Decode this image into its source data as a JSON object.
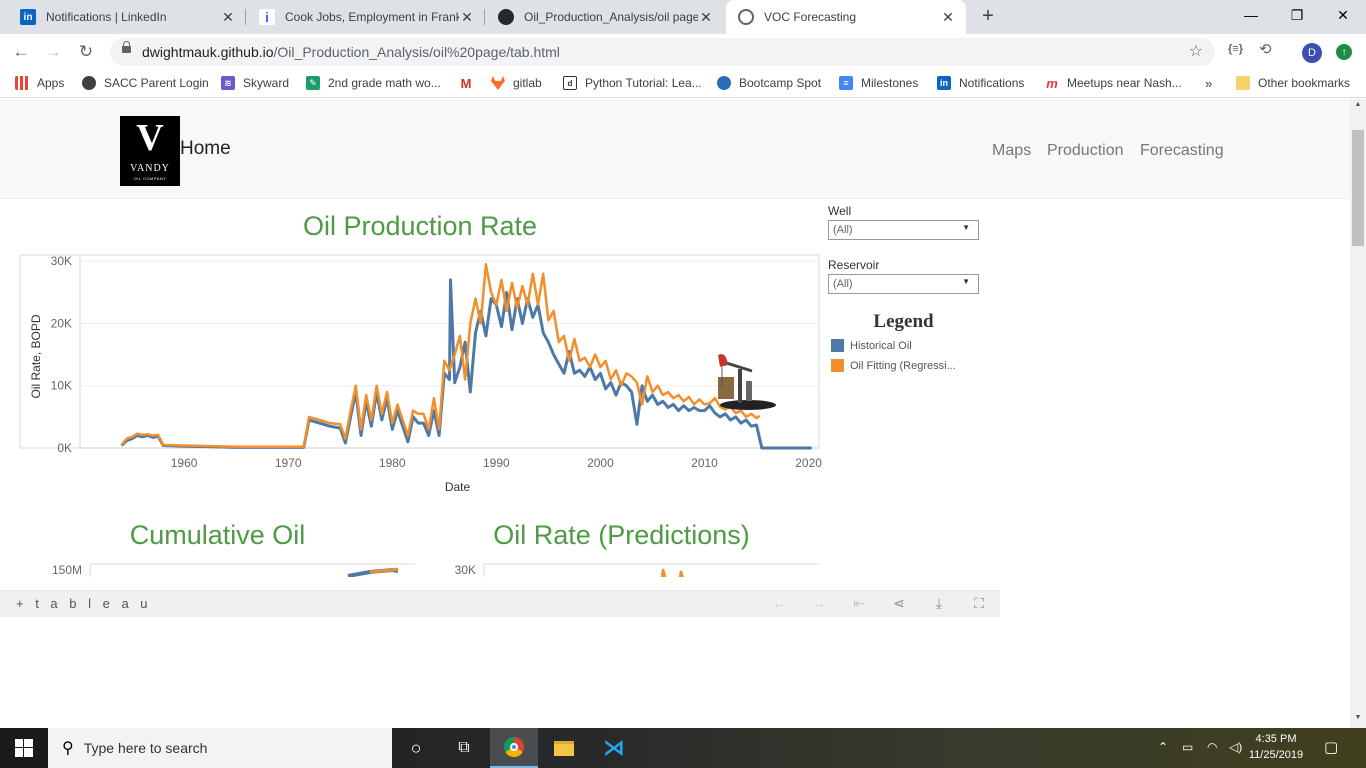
{
  "browser": {
    "tabs": [
      {
        "title": "Notifications | LinkedIn",
        "icon": "linkedin-icon",
        "color": "#0a66c2",
        "glyph": "in"
      },
      {
        "title": "Cook Jobs, Employment in Frankl",
        "icon": "indeed-icon",
        "color": "#2164f3",
        "glyph": "i"
      },
      {
        "title": "Oil_Production_Analysis/oil page",
        "icon": "github-icon",
        "color": "#24292e",
        "glyph": "●"
      },
      {
        "title": "VOC Forecasting",
        "icon": "globe-icon",
        "color": "#5f6368",
        "glyph": "◍"
      }
    ],
    "url_host": "dwightmauk.github.io",
    "url_path": "/Oil_Production_Analysis/oil%20page/tab.html",
    "profile_initial": "D",
    "bookmarks": [
      {
        "label": "Apps",
        "icon": "apps-grid-icon",
        "color": "#ea4335"
      },
      {
        "label": "SACC Parent Login",
        "icon": "globe-icon",
        "color": "#3c4043"
      },
      {
        "label": "Skyward",
        "icon": "skyward-icon",
        "color": "#6a5acd"
      },
      {
        "label": "2nd grade math wo...",
        "icon": "math-worksheet-icon",
        "color": "#1a9e6a"
      },
      {
        "label": "",
        "icon": "gmail-icon",
        "color": "#d93025"
      },
      {
        "label": "gitlab",
        "icon": "gitlab-icon",
        "color": "#fc6d26"
      },
      {
        "label": "Python Tutorial: Lea...",
        "icon": "datacamp-icon",
        "color": "#333333"
      },
      {
        "label": "Bootcamp Spot",
        "icon": "bootcamp-icon",
        "color": "#2a6ebb"
      },
      {
        "label": "Milestones",
        "icon": "docs-icon",
        "color": "#4285f4"
      },
      {
        "label": "Notifications",
        "icon": "linkedin-icon",
        "color": "#0a66c2"
      },
      {
        "label": "Meetups near Nash...",
        "icon": "meetup-icon",
        "color": "#e0393e"
      }
    ],
    "overflow": "»",
    "other_bookmarks": "Other bookmarks"
  },
  "site": {
    "logo_mark": "V",
    "logo_word": "VANDY",
    "logo_sub": "OIL COMPANY",
    "home": "Home",
    "nav": [
      "Maps",
      "Production",
      "Forecasting"
    ]
  },
  "viz": {
    "filters": [
      {
        "label": "Well",
        "value": "(All)"
      },
      {
        "label": "Reservoir",
        "value": "(All)"
      }
    ],
    "legend_title": "Legend",
    "legend": [
      {
        "label": "Historical Oil",
        "color": "#4e79a7"
      },
      {
        "label": "Oil Fitting (Regressi...",
        "color": "#f28e2b"
      }
    ],
    "titles": {
      "main": "Oil Production Rate",
      "cumulative": "Cumulative Oil",
      "predictions": "Oil Rate (Predictions)"
    },
    "footer_brand": "+ t a b l e a u"
  },
  "chart_data": [
    {
      "type": "line",
      "title": "Oil Production Rate",
      "xlabel": "Date",
      "ylabel": "Oil Rate, BOPD",
      "xlim": [
        1950,
        2021
      ],
      "ylim": [
        0,
        31000
      ],
      "xticks": [
        1960,
        1970,
        1980,
        1990,
        2000,
        2010,
        2020
      ],
      "xtick_labels": [
        "1960",
        "1970",
        "1980",
        "1990",
        "2000",
        "2010",
        "2020"
      ],
      "yticks": [
        0,
        10000,
        20000,
        30000
      ],
      "ytick_labels": [
        "0K",
        "10K",
        "20K",
        "30K"
      ],
      "grid": true,
      "series": [
        {
          "name": "Historical Oil",
          "color": "#4e79a7",
          "x": [
            1954,
            1954.5,
            1955,
            1955.5,
            1956,
            1956.5,
            1957,
            1957.5,
            1958,
            1960,
            1965,
            1971.5,
            1972,
            1973,
            1974,
            1975,
            1975.5,
            1976,
            1976.5,
            1977,
            1977.5,
            1978,
            1978.5,
            1979,
            1979.5,
            1980,
            1980.5,
            1981,
            1981.5,
            1982,
            1982.5,
            1983,
            1983.5,
            1984,
            1984.5,
            1985,
            1985.5,
            1985.6,
            1986,
            1986.5,
            1987,
            1987.5,
            1988,
            1988.5,
            1989,
            1989.5,
            1990,
            1990.5,
            1991,
            1991.5,
            1992,
            1992.5,
            1993,
            1993.5,
            1994,
            1994.5,
            1995,
            1995.5,
            1996,
            1996.5,
            1997,
            1997.5,
            1998,
            1998.5,
            1999,
            1999.5,
            2000,
            2000.5,
            2001,
            2001.5,
            2002,
            2002.5,
            2003,
            2003.5,
            2004,
            2004.5,
            2005,
            2005.5,
            2006,
            2006.5,
            2007,
            2007.5,
            2008,
            2008.5,
            2009,
            2009.5,
            2010,
            2010.5,
            2011,
            2011.5,
            2012,
            2012.5,
            2013,
            2013.5,
            2014,
            2014.5,
            2015,
            2015.5,
            2016,
            2018,
            2020.3
          ],
          "y": [
            400,
            1200,
            1500,
            2000,
            1800,
            2000,
            1700,
            1900,
            400,
            300,
            100,
            100,
            4500,
            4000,
            3500,
            3200,
            800,
            5000,
            9000,
            2000,
            7500,
            3500,
            9000,
            4500,
            8000,
            3000,
            6000,
            3500,
            1000,
            5000,
            4000,
            4000,
            2000,
            6000,
            2000,
            12000,
            11000,
            27000,
            10500,
            13000,
            17000,
            9000,
            18500,
            22000,
            18000,
            24000,
            23000,
            19500,
            25000,
            19000,
            24000,
            20000,
            24000,
            21000,
            23000,
            18500,
            17000,
            15000,
            13500,
            12000,
            15500,
            12000,
            12500,
            11500,
            13000,
            11000,
            12000,
            9500,
            10500,
            8500,
            10500,
            10000,
            9000,
            3800,
            10000,
            7500,
            8500,
            7000,
            7500,
            6500,
            7000,
            6000,
            6800,
            6000,
            6500,
            6000,
            6000,
            6800,
            5600,
            5000,
            5500,
            4500,
            5000,
            4000,
            4500,
            3500,
            3700,
            0,
            0,
            0,
            0
          ]
        },
        {
          "name": "Oil Fitting (Regressi...",
          "color": "#f28e2b",
          "x": [
            1954,
            1954.5,
            1955,
            1955.5,
            1956,
            1956.5,
            1957,
            1957.5,
            1958,
            1960,
            1965,
            1971.5,
            1972,
            1973,
            1974,
            1975,
            1975.5,
            1976,
            1976.5,
            1977,
            1977.5,
            1978,
            1978.5,
            1979,
            1979.5,
            1980,
            1980.5,
            1981,
            1981.5,
            1982,
            1982.5,
            1983,
            1983.5,
            1984,
            1984.5,
            1985,
            1985.5,
            1986,
            1986.5,
            1987,
            1987.5,
            1988,
            1988.5,
            1989,
            1989.5,
            1990,
            1990.5,
            1991,
            1991.5,
            1992,
            1992.5,
            1993,
            1993.5,
            1994,
            1994.5,
            1995,
            1995.5,
            1996,
            1996.5,
            1997,
            1997.5,
            1998,
            1998.5,
            1999,
            1999.5,
            2000,
            2000.5,
            2001,
            2001.5,
            2002,
            2002.5,
            2003,
            2003.5,
            2004,
            2004.5,
            2005,
            2005.5,
            2006,
            2006.5,
            2007,
            2007.5,
            2008,
            2008.5,
            2009,
            2009.5,
            2010,
            2010.5,
            2011,
            2011.5,
            2012,
            2012.5,
            2013,
            2013.5,
            2014,
            2014.5,
            2015,
            2015.3
          ],
          "y": [
            500,
            1500,
            1800,
            2300,
            2100,
            2200,
            2000,
            2100,
            500,
            400,
            200,
            200,
            5000,
            4500,
            4000,
            3800,
            1500,
            6000,
            10000,
            3000,
            8500,
            4500,
            10000,
            5500,
            9000,
            4000,
            7000,
            4500,
            2000,
            6000,
            5500,
            5500,
            3000,
            8000,
            3000,
            14000,
            12500,
            15000,
            18000,
            11000,
            20000,
            24000,
            20000,
            29500,
            25000,
            23000,
            27000,
            22000,
            26500,
            22500,
            26000,
            23000,
            28000,
            23000,
            28000,
            20500,
            22000,
            17000,
            18000,
            14000,
            17500,
            14000,
            14500,
            13000,
            15000,
            13000,
            14000,
            11000,
            12500,
            10000,
            12000,
            11500,
            10500,
            7000,
            11500,
            9000,
            10000,
            8500,
            9000,
            8000,
            8500,
            7500,
            8200,
            7000,
            7800,
            7000,
            7200,
            8000,
            6600,
            6200,
            6600,
            5600,
            6000,
            5000,
            5500,
            4800,
            5200
          ]
        }
      ]
    },
    {
      "type": "line",
      "title": "Cumulative Oil",
      "yticks": [
        150000000
      ],
      "ytick_labels": [
        "150M"
      ],
      "series": [
        {
          "name": "Historical Oil",
          "color": "#4e79a7"
        },
        {
          "name": "Oil Fitting (Regressi...",
          "color": "#f28e2b"
        }
      ]
    },
    {
      "type": "line",
      "title": "Oil Rate (Predictions)",
      "yticks": [
        30000
      ],
      "ytick_labels": [
        "30K"
      ],
      "series": [
        {
          "name": "Oil Fitting (Regressi...",
          "color": "#f28e2b"
        }
      ]
    }
  ],
  "taskbar": {
    "search_placeholder": "Type here to search",
    "time": "4:35 PM",
    "date": "11/25/2019"
  }
}
